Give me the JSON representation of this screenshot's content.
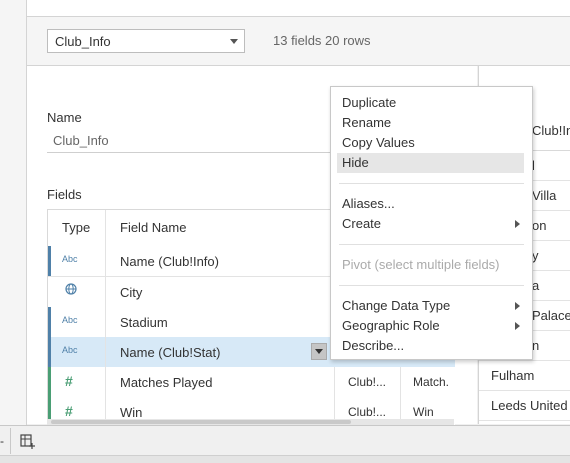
{
  "toolbar": {
    "table_select": "Club_Info",
    "field_count": "13 fields 20 rows"
  },
  "details": {
    "name_label": "Name",
    "name_value": "Club_Info",
    "fields_label": "Fields"
  },
  "table": {
    "headers": {
      "type": "Type",
      "field_name": "Field Name"
    },
    "rows": [
      {
        "type": "Abc",
        "name": "Name (Club!Info)"
      },
      {
        "type": "globe-icon",
        "name": "City"
      },
      {
        "type": "Abc",
        "name": "Stadium"
      },
      {
        "type": "Abc",
        "name": "Name (Club!Stat)"
      },
      {
        "type": "#",
        "name": "Matches Played",
        "table": "Club!...",
        "remote": "Match."
      },
      {
        "type": "#",
        "name": "Win",
        "table": "Club!...",
        "remote": "Win"
      }
    ]
  },
  "preview": {
    "header": "Club!In",
    "rows": [
      "l",
      "Villa",
      "on",
      "y",
      "a",
      "Palace",
      "n",
      "Fulham",
      "Leeds United"
    ]
  },
  "context_menu": {
    "items": [
      {
        "label": "Duplicate"
      },
      {
        "label": "Rename"
      },
      {
        "label": "Copy Values"
      },
      {
        "label": "Hide",
        "highlighted": true
      },
      {
        "label": "Aliases..."
      },
      {
        "label": "Create",
        "submenu": true
      },
      {
        "label": "Pivot (select multiple fields)",
        "disabled": true
      },
      {
        "label": "Change Data Type",
        "submenu": true
      },
      {
        "label": "Geographic Role",
        "submenu": true
      },
      {
        "label": "Describe..."
      }
    ]
  },
  "bottom": {
    "left_glyph": "-",
    "new_sheet_icon": "new-worksheet-icon"
  },
  "colors": {
    "selected_row": "#d7e9f7",
    "dimension_bar": "#4f80a8",
    "measure_bar": "#4a9e74",
    "measure_icon": "#4a9e74"
  }
}
